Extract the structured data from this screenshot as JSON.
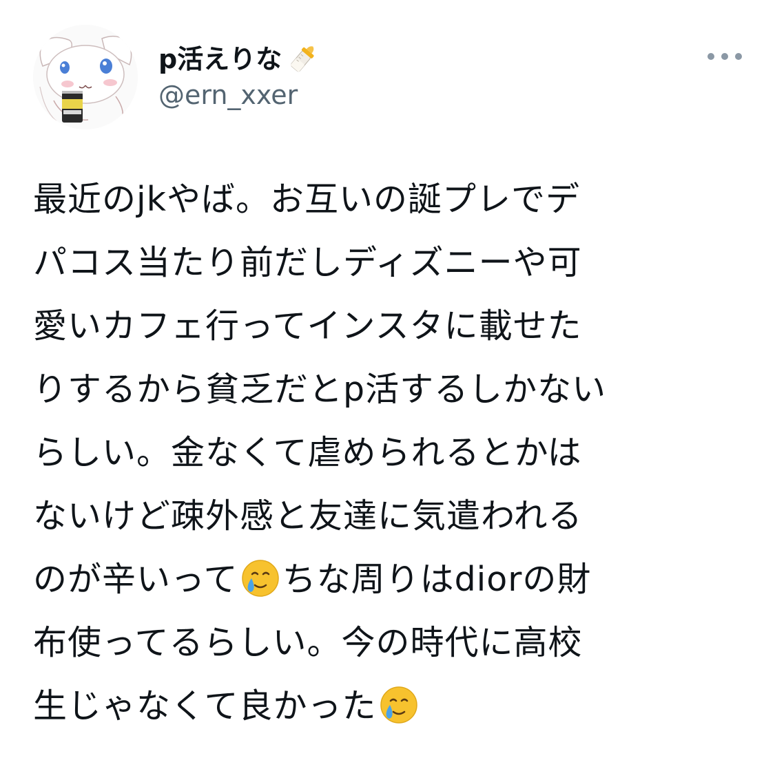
{
  "tweet": {
    "author": {
      "display_name": "p活えりな",
      "name_emoji": "baby-bottle-icon",
      "handle": "@ern_xxer",
      "avatar": "avatar-icon"
    },
    "more_icon": "more-icon",
    "text_lines": [
      "最近のjkやば。お互いの誕プレでデ",
      "パコス当たり前だしディズニーや可",
      "愛いカフェ行ってインスタに載せた",
      "りするから貧乏だとp活するしかない",
      "らしい。金なくて虐められるとかは",
      "ないけど疎外感と友達に気遣われる"
    ],
    "line7": {
      "before": "のが辛いって",
      "after": "ちな周りはdiorの財"
    },
    "line8": "布使ってるらしい。今の時代に高校",
    "line9": {
      "before": "生じゃなくて良かった"
    },
    "emoji": "face-holding-back-tears-icon"
  },
  "colors": {
    "text": "#0f1419",
    "secondary": "#536471",
    "icon": "#8b98a5",
    "background": "#ffffff"
  }
}
